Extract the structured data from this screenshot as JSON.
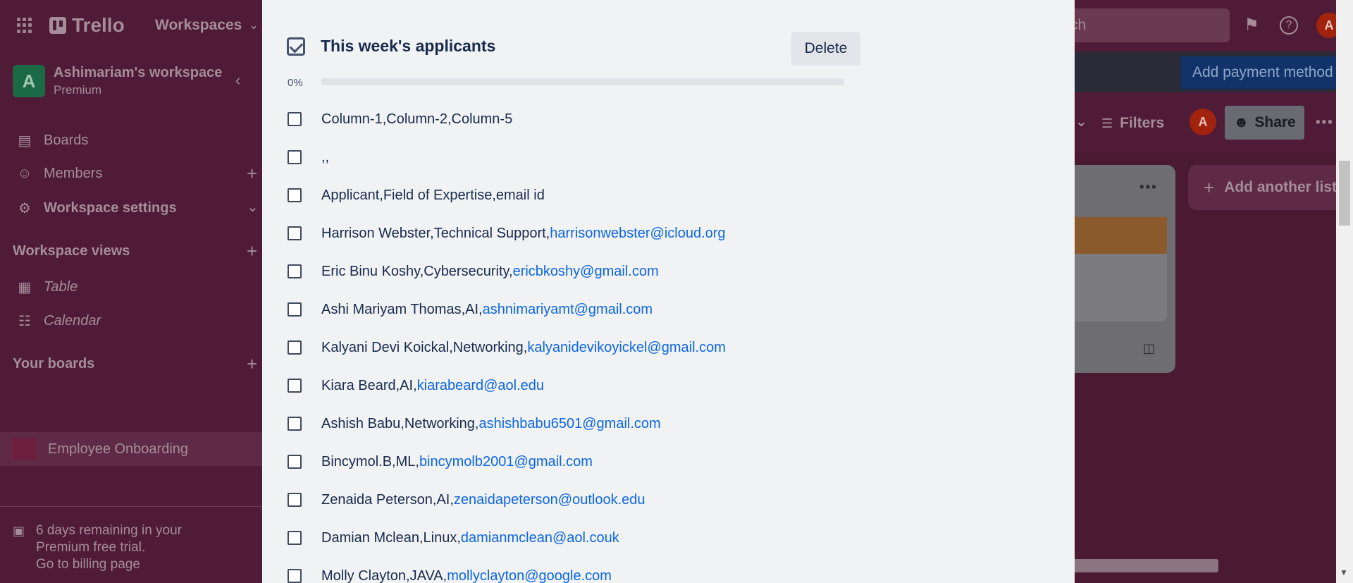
{
  "topbar": {
    "apps_icon": "grid-icon",
    "logo": "Trello",
    "workspaces_label": "Workspaces",
    "search_placeholder": "rch",
    "notification_icon": "megaphone-icon",
    "help_icon": "help-icon",
    "avatar_initial": "A"
  },
  "sidebar": {
    "workspace_initial": "A",
    "workspace_name": "Ashimariam's workspace",
    "workspace_plan": "Premium",
    "items": [
      {
        "label": "Boards",
        "icon": "board-icon"
      },
      {
        "label": "Members",
        "icon": "person-icon"
      },
      {
        "label": "Workspace settings",
        "icon": "gear-icon"
      }
    ],
    "views_heading": "Workspace views",
    "views": [
      {
        "label": "Table",
        "icon": "table-icon"
      },
      {
        "label": "Calendar",
        "icon": "calendar-icon"
      }
    ],
    "boards_heading": "Your boards",
    "board": "Employee Onboarding",
    "trial_line1": "6 days remaining in your",
    "trial_line2": "Premium free trial.",
    "trial_line3": "Go to billing page"
  },
  "board": {
    "payment_button": "Add payment method",
    "filters_label": "Filters",
    "share_label": "Share",
    "member_initial": "A",
    "add_list_label": "Add another list"
  },
  "checklist": {
    "title": "This week's applicants",
    "delete_label": "Delete",
    "progress_text": "0%",
    "progress_value": 0,
    "items": [
      {
        "text": "Column-1,Column-2,Column-5",
        "email": ""
      },
      {
        "text": ",,",
        "email": ""
      },
      {
        "text": "Applicant,Field of Expertise,email id",
        "email": ""
      },
      {
        "text": "Harrison Webster,Technical Support,",
        "email": "harrisonwebster@icloud.org"
      },
      {
        "text": "Eric Binu Koshy,Cybersecurity,",
        "email": "ericbkoshy@gmail.com"
      },
      {
        "text": "Ashi Mariyam Thomas,AI,",
        "email": "ashnimariyamt@gmail.com"
      },
      {
        "text": "Kalyani Devi Koickal,Networking,",
        "email": "kalyanidevikoyickel@gmail.com"
      },
      {
        "text": "Kiara Beard,AI,",
        "email": "kiarabeard@aol.edu"
      },
      {
        "text": "Ashish Babu,Networking,",
        "email": "ashishbabu6501@gmail.com"
      },
      {
        "text": "Bincymol.B,ML,",
        "email": "bincymolb2001@gmail.com"
      },
      {
        "text": "Zenaida Peterson,AI,",
        "email": "zenaidapeterson@outlook.edu"
      },
      {
        "text": "Damian Mclean,Linux,",
        "email": "damianmclean@aol.couk"
      },
      {
        "text": "Molly Clayton,JAVA,",
        "email": "mollyclayton@google.com"
      }
    ]
  },
  "colors": {
    "link": "#0c66e4",
    "text": "#172b4d",
    "modal_bg": "#f1f2f4",
    "overlay_bg": "#4f1b36"
  }
}
